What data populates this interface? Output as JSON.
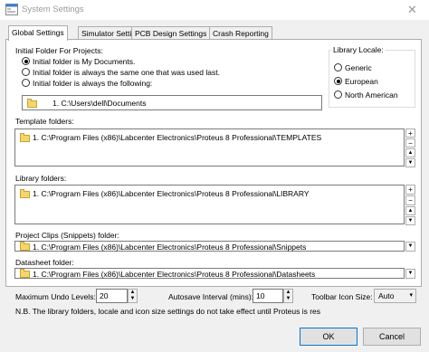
{
  "window": {
    "title": "System Settings",
    "close_glyph": "✕"
  },
  "tabs": [
    {
      "label": "Global Settings",
      "active": true
    },
    {
      "label": "Simulator Settings",
      "active": false
    },
    {
      "label": "PCB Design Settings",
      "active": false
    },
    {
      "label": "Crash Reporting",
      "active": false
    }
  ],
  "initial_folder": {
    "heading": "Initial Folder For Projects:",
    "options": [
      {
        "label": "Initial folder is My Documents.",
        "selected": true
      },
      {
        "label": "Initial folder is always the same one that was used last.",
        "selected": false
      },
      {
        "label": "Initial folder is always the following:",
        "selected": false
      }
    ],
    "path": "1.  C:\\Users\\dell\\Documents"
  },
  "library_locale": {
    "heading": "Library Locale:",
    "options": [
      {
        "label": "Generic",
        "selected": false
      },
      {
        "label": "European",
        "selected": true
      },
      {
        "label": "North American",
        "selected": false
      }
    ]
  },
  "template_folders": {
    "label": "Template folders:",
    "items": [
      "1.  C:\\Program Files (x86)\\Labcenter Electronics\\Proteus 8 Professional\\TEMPLATES"
    ]
  },
  "library_folders": {
    "label": "Library folders:",
    "items": [
      "1.  C:\\Program Files (x86)\\Labcenter Electronics\\Proteus 8 Professional\\LIBRARY"
    ]
  },
  "project_clips": {
    "label": "Project Clips (Snippets) folder:",
    "path": "1.  C:\\Program Files (x86)\\Labcenter Electronics\\Proteus 8 Professional\\Snippets"
  },
  "datasheet": {
    "label": "Datasheet folder:",
    "path": "1.  C:\\Program Files (x86)\\Labcenter Electronics\\Proteus 8 Professional\\Datasheets"
  },
  "bottom": {
    "undo_label": "Maximum Undo Levels:",
    "undo_value": "20",
    "autosave_label": "Autosave Interval (mins):",
    "autosave_value": "10",
    "icon_size_label": "Toolbar Icon Size:",
    "icon_size_value": "Auto",
    "note": "N.B. The library folders, locale and icon size settings do not take effect until Proteus is res"
  },
  "buttons": {
    "ok": "OK",
    "cancel": "Cancel"
  },
  "glyphs": {
    "plus": "+",
    "minus": "−",
    "up": "▲",
    "down": "▼",
    "dd": "▾"
  }
}
